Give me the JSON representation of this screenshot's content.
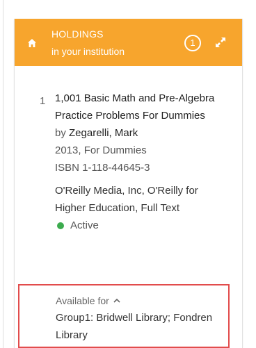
{
  "header": {
    "title": "HOLDINGS",
    "subtitle": "in your institution",
    "count": "1",
    "icons": {
      "home": "home-icon",
      "expand": "expand-icon"
    },
    "color": "#f7a52d"
  },
  "record": {
    "number": "1",
    "title": "1,001 Basic Math and Pre-Algebra Practice Problems For Dummies",
    "by_label": "by",
    "author": "Zegarelli, Mark",
    "year_publisher": "2013, For Dummies",
    "isbn": "ISBN 1-118-44645-3",
    "provider": "O'Reilly Media, Inc, O'Reilly for Higher Education, Full Text",
    "status": "Active",
    "status_color": "#3cab4e"
  },
  "availability": {
    "label": "Available for",
    "groups": "Group1: Bridwell Library; Fondren Library",
    "highlight_color": "#e24c4c",
    "toggle_icon": "chevron-up-icon"
  }
}
